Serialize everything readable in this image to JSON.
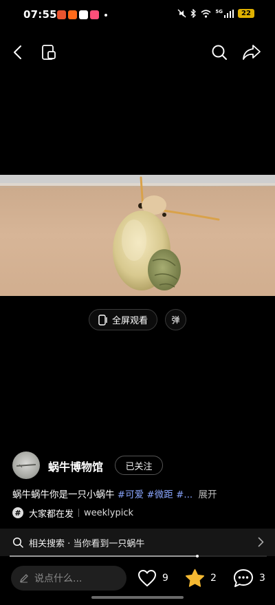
{
  "status_bar": {
    "time": "07:55",
    "signal": "5G",
    "battery": "22"
  },
  "video": {
    "description_icon": "snail-video-frame"
  },
  "controls": {
    "fullscreen_label": "全屏观看",
    "danmu_label": "弹"
  },
  "author": {
    "name": "蜗牛博物馆",
    "follow_label": "已关注"
  },
  "caption": {
    "text": "蜗牛蜗牛你是一只小蜗牛",
    "tags": [
      "#可爱",
      "#微距",
      "#..."
    ],
    "more": "展开"
  },
  "topic": {
    "primary": "大家都在发",
    "secondary": "weeklypick"
  },
  "related": {
    "label": "相关搜索 · 当你看到一只蜗牛"
  },
  "progress": {
    "fraction": 0.73
  },
  "bottom": {
    "comment_placeholder": "说点什么...",
    "likes": "9",
    "stars": "2",
    "comments": "3"
  },
  "colors": {
    "tag": "#8aa6ff",
    "star": "#f5b932",
    "battery": "#e0b100"
  }
}
